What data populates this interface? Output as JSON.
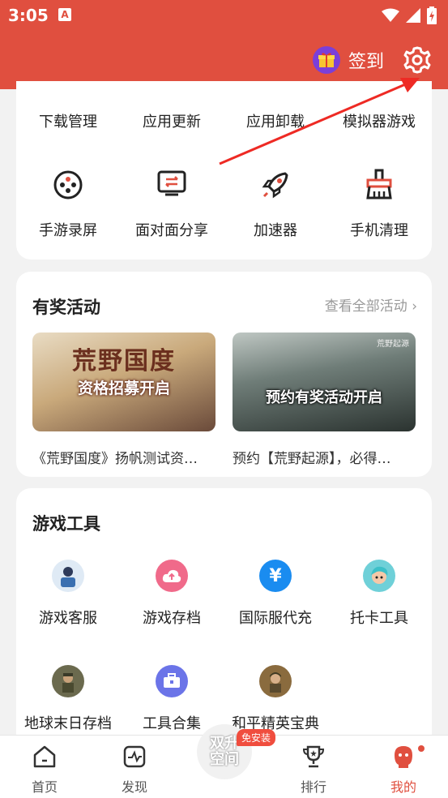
{
  "status": {
    "time": "3:05",
    "notif_icon": "A"
  },
  "header": {
    "signin_label": "签到",
    "signin_icon": "gift-icon",
    "settings_icon": "gear-icon"
  },
  "quick_tools": {
    "row1": [
      "下载管理",
      "应用更新",
      "应用卸载",
      "模拟器游戏"
    ],
    "row2": [
      {
        "label": "手游录屏",
        "icon": "gamepad-record-icon"
      },
      {
        "label": "面对面分享",
        "icon": "share-screen-icon"
      },
      {
        "label": "加速器",
        "icon": "rocket-icon"
      },
      {
        "label": "手机清理",
        "icon": "broom-icon"
      }
    ]
  },
  "activities": {
    "title": "有奖活动",
    "see_all": "查看全部活动",
    "items": [
      {
        "banner_title": "荒野国度",
        "banner_sub": "资格招募开启",
        "caption": "《荒野国度》扬帆测试资…"
      },
      {
        "banner_title": "预约有奖活动开启",
        "banner_tag": "荒野起源",
        "caption": "预约【荒野起源】，必得…"
      }
    ]
  },
  "game_tools": {
    "title": "游戏工具",
    "items": [
      {
        "label": "游戏客服",
        "icon": "customer-service-icon",
        "color": "#7aa9d8"
      },
      {
        "label": "游戏存档",
        "icon": "cloud-upload-icon",
        "color": "#f06a8a"
      },
      {
        "label": "国际服代充",
        "icon": "yen-icon",
        "color": "#1a8cf0"
      },
      {
        "label": "托卡工具",
        "icon": "toca-avatar-icon",
        "color": "#6fd0d8"
      },
      {
        "label": "地球末日存档",
        "icon": "soldier-avatar-icon",
        "color": "#6b6a4e"
      },
      {
        "label": "工具合集",
        "icon": "toolbox-icon",
        "color": "#6b74e8"
      },
      {
        "label": "和平精英宝典",
        "icon": "pubg-avatar-icon",
        "color": "#8a6b3e"
      }
    ]
  },
  "bottom_nav": {
    "items": [
      {
        "label": "首页",
        "icon": "home-icon"
      },
      {
        "label": "发现",
        "icon": "discover-icon"
      },
      {
        "label": "排行",
        "icon": "trophy-icon"
      },
      {
        "label": "我的",
        "icon": "profile-icon"
      }
    ],
    "center_label_1": "双升",
    "center_label_2": "空间",
    "center_badge": "免安装"
  },
  "colors": {
    "accent": "#e04f3f",
    "header_bg": "#e04f3f"
  }
}
